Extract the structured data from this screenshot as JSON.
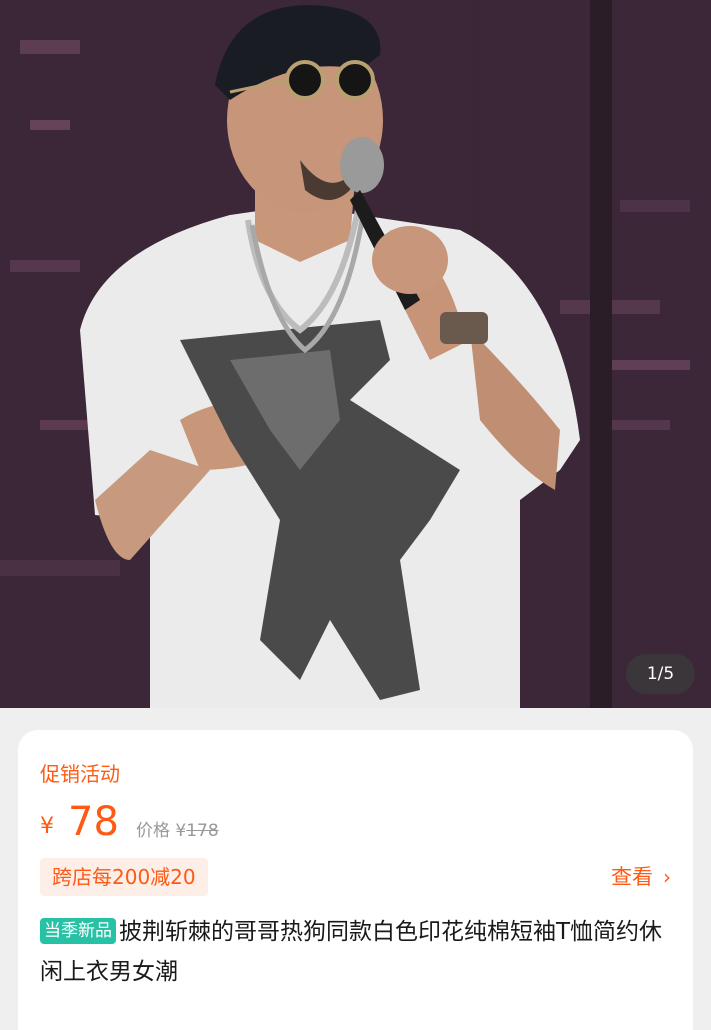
{
  "gallery": {
    "counter": "1/5"
  },
  "promo": {
    "title": "促销活动",
    "currency": "¥",
    "price": "78",
    "original_label": "价格 ¥",
    "original_price": "178",
    "coupon": "跨店每200减20",
    "view_label": "查看"
  },
  "product": {
    "badge": "当季新品",
    "title": "披荆斩棘的哥哥热狗同款白色印花纯棉短袖T恤简约休闲上衣男女潮"
  },
  "colors": {
    "accent": "#ff5a14",
    "badge": "#27c2a5"
  }
}
